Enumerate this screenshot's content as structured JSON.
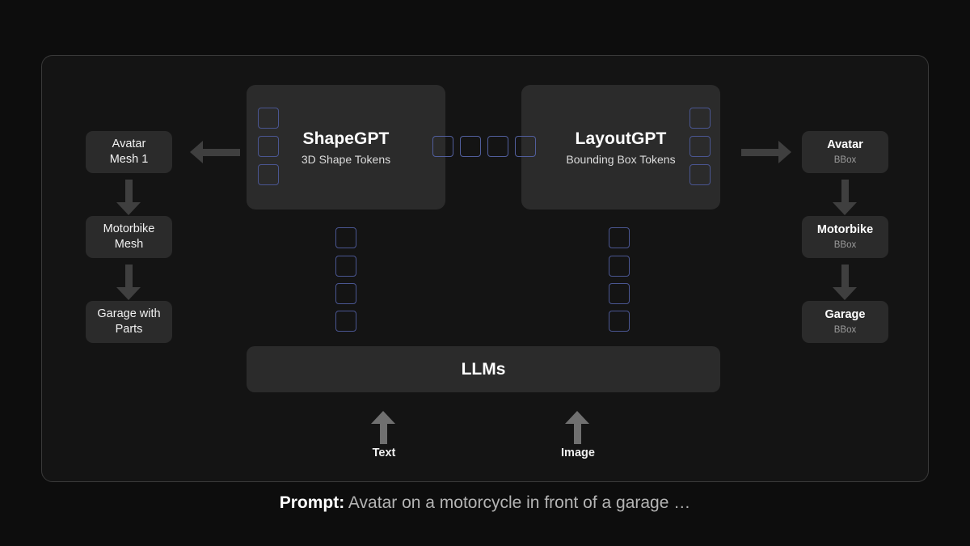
{
  "background_color": "#0d0d0d",
  "frame": {
    "border_color": "#3a3a3a",
    "fill_color": "#141414"
  },
  "accent_token_color": "#4a5691",
  "left_column": {
    "name": "mesh-outputs",
    "nodes": [
      {
        "line1": "Avatar",
        "line2": "Mesh 1"
      },
      {
        "line1": "Motorbike",
        "line2": "Mesh"
      },
      {
        "line1": "Garage with",
        "line2": "Parts"
      }
    ]
  },
  "right_column": {
    "name": "bbox-outputs",
    "nodes": [
      {
        "title": "Avatar",
        "subtitle": "BBox"
      },
      {
        "title": "Motorbike",
        "subtitle": "BBox"
      },
      {
        "title": "Garage",
        "subtitle": "BBox"
      }
    ]
  },
  "panels": [
    {
      "title": "ShapeGPT",
      "subtitle": "3D Shape Tokens",
      "side_tokens": 3
    },
    {
      "title": "LayoutGPT",
      "subtitle": "Bounding Box Tokens",
      "side_tokens": 3
    }
  ],
  "middle_tokens": {
    "count": 4
  },
  "token_columns": {
    "shape_tokens": {
      "count": 4
    },
    "layout_tokens": {
      "count": 4
    }
  },
  "llm": {
    "label": "LLMs"
  },
  "inputs": [
    {
      "label": "Text",
      "icon": "arrow-up-icon"
    },
    {
      "label": "Image",
      "icon": "arrow-up-icon"
    }
  ],
  "arrows": {
    "to_mesh": "arrow-left-icon",
    "to_bbox": "arrow-right-icon",
    "down": "arrow-down-icon"
  },
  "prompt": {
    "key": "Prompt:",
    "text": "Avatar on a motorcycle in front of a garage …"
  }
}
